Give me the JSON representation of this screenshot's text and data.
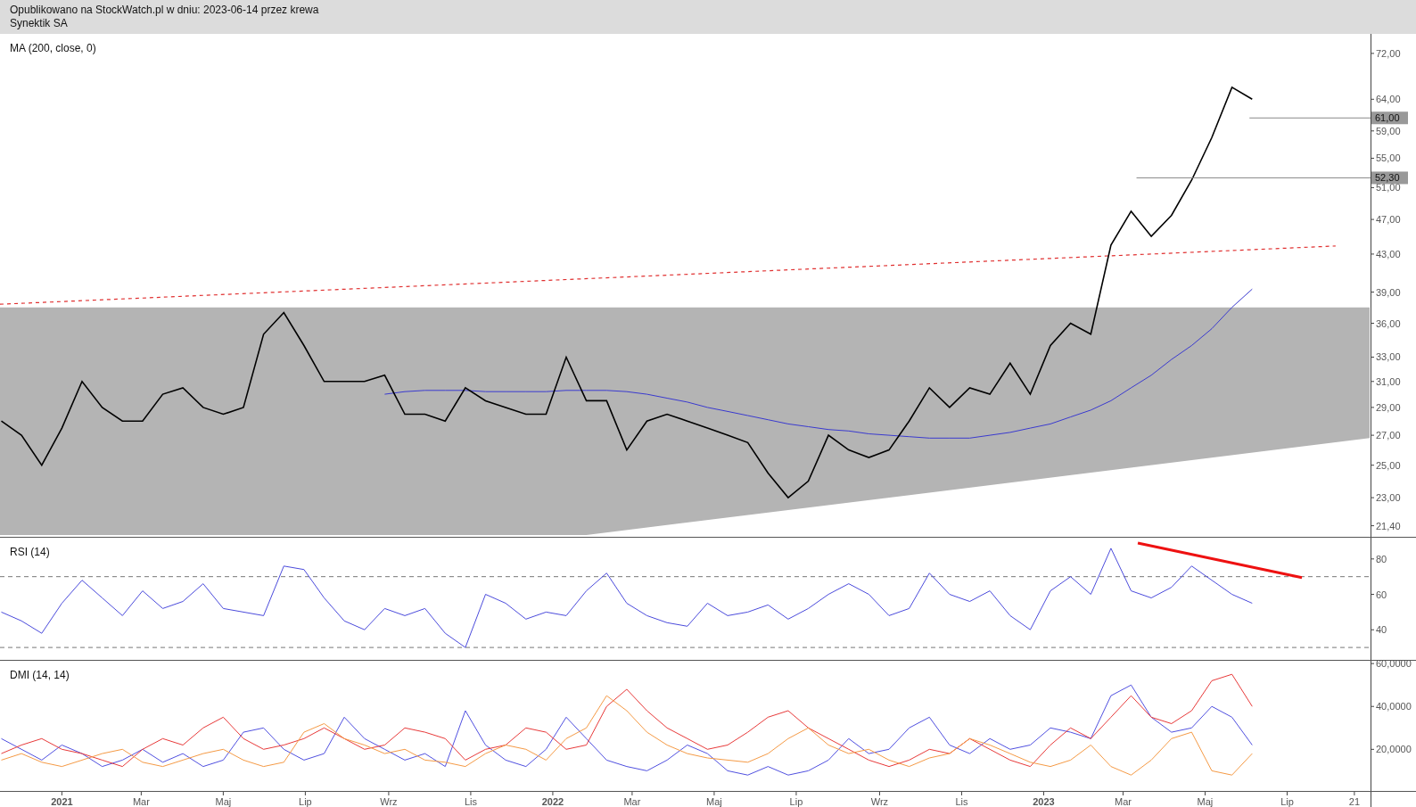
{
  "header": {
    "lines": [
      "Opublikowano na StockWatch.pl w dniu: 2023-06-14 przez krewa",
      "Synektik SA"
    ]
  },
  "price_panel": {
    "title": "MA (200, close, 0)",
    "axis_labels": [
      "72,00",
      "64,00",
      "59,00",
      "55,00",
      "51,00",
      "47,00",
      "43,00",
      "39,00",
      "36,00",
      "33,00",
      "31,00",
      "29,00",
      "27,00",
      "25,00",
      "23,00",
      "21,40"
    ],
    "level_tags": [
      "61,00",
      "52,30"
    ]
  },
  "indicator_panels": [
    {
      "kind": "rsi",
      "title": "RSI (14)",
      "axis_labels": [
        "80",
        "60",
        "40"
      ]
    },
    {
      "kind": "dmi",
      "title": "DMI (14, 14)",
      "axis_labels": [
        "60,0000",
        "40,0000",
        "20,0000"
      ]
    }
  ],
  "time_axis": {
    "labels": [
      {
        "text": "2021",
        "year": true
      },
      {
        "text": "Mar",
        "year": false
      },
      {
        "text": "Maj",
        "year": false
      },
      {
        "text": "Lip",
        "year": false
      },
      {
        "text": "Wrz",
        "year": false
      },
      {
        "text": "Lis",
        "year": false
      },
      {
        "text": "2022",
        "year": true
      },
      {
        "text": "Mar",
        "year": false
      },
      {
        "text": "Maj",
        "year": false
      },
      {
        "text": "Lip",
        "year": false
      },
      {
        "text": "Wrz",
        "year": false
      },
      {
        "text": "Lis",
        "year": false
      },
      {
        "text": "2023",
        "year": true
      },
      {
        "text": "Mar",
        "year": false
      },
      {
        "text": "Maj",
        "year": false
      },
      {
        "text": "Lip",
        "year": false
      },
      {
        "text": "21",
        "year": false
      }
    ]
  }
}
